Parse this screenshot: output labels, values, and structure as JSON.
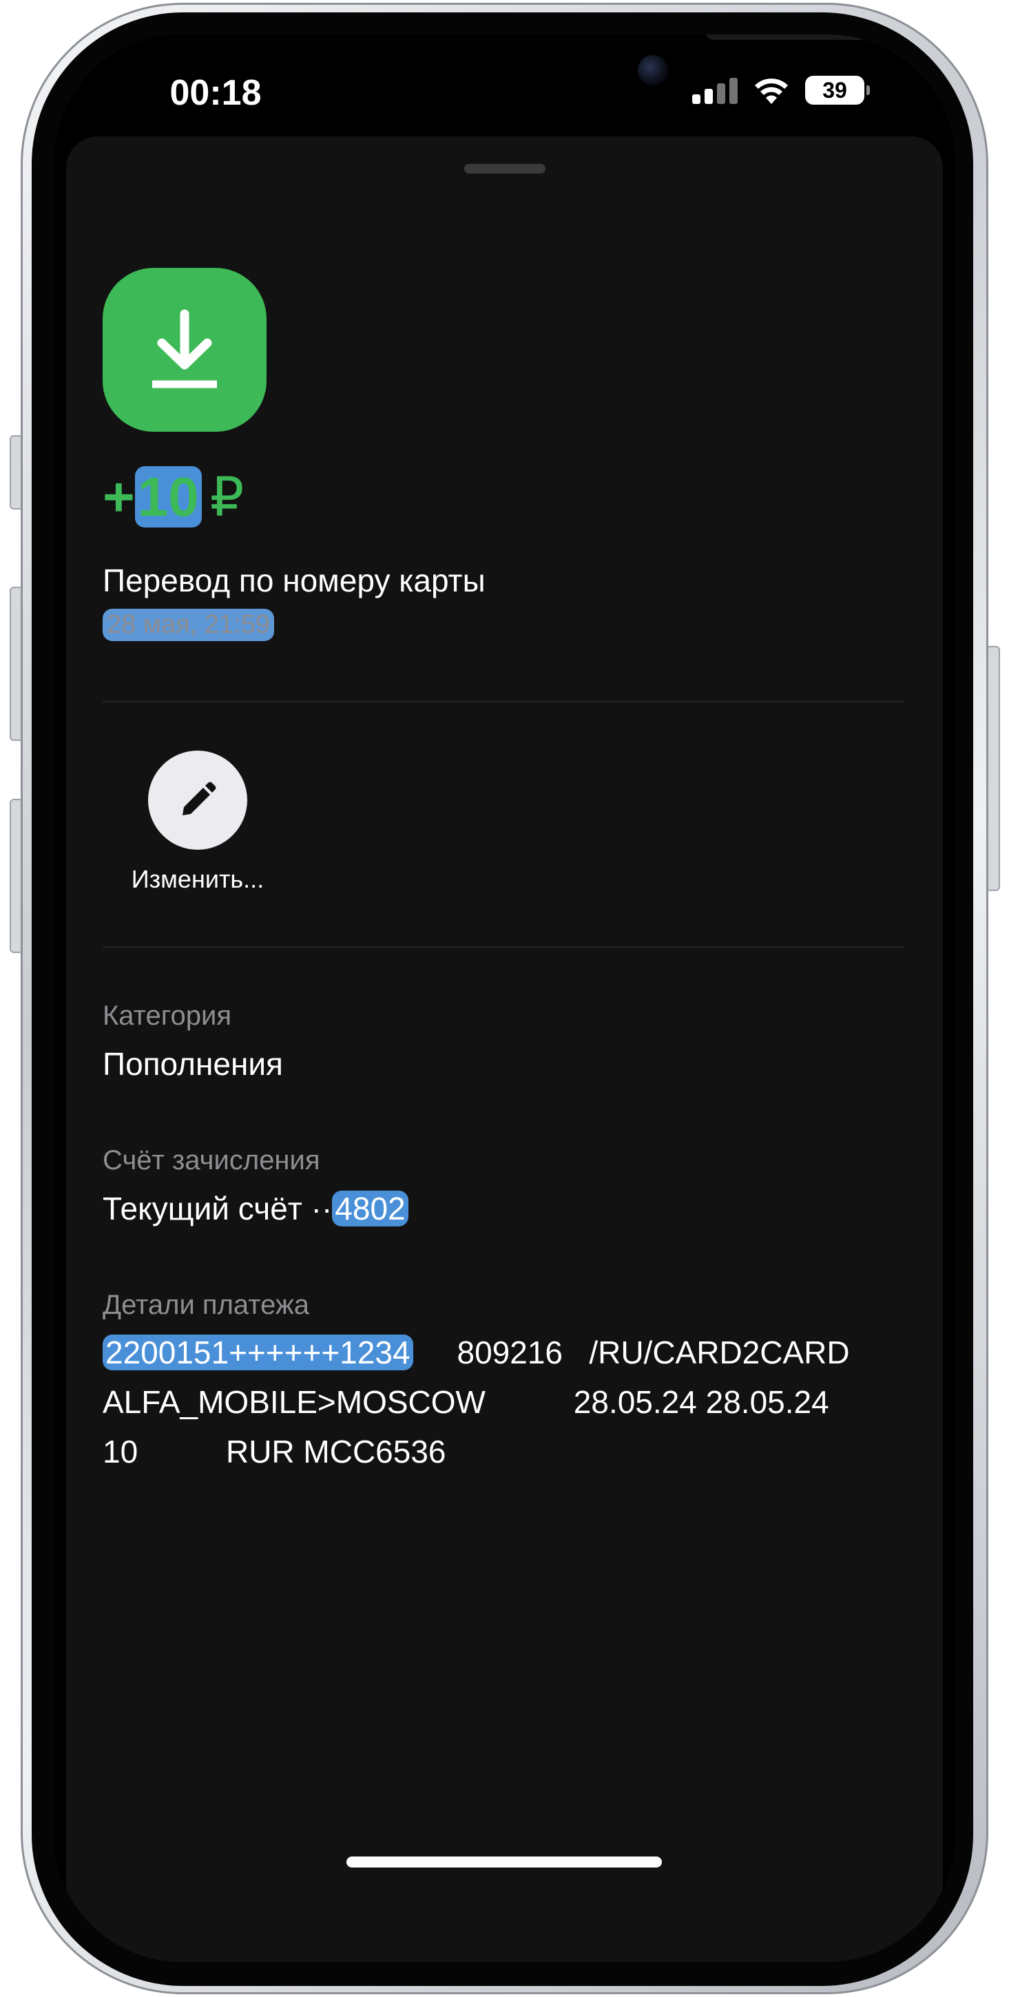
{
  "status_bar": {
    "time": "00:18",
    "battery_level": "39",
    "icons": [
      "cellular-signal-icon",
      "wifi-icon",
      "battery-icon"
    ]
  },
  "operation": {
    "icon": "download-arrow-icon",
    "icon_color": "#3dba57",
    "amount_sign": "+",
    "amount_value": "10",
    "currency": "₽",
    "title": "Перевод по номеру карты",
    "datetime": "28 мая, 21:59"
  },
  "actions": {
    "edit_label": "Изменить...",
    "edit_icon": "pencil-icon"
  },
  "fields": {
    "category": {
      "label": "Категория",
      "value": "Пополнения"
    },
    "account": {
      "label": "Счёт зачисления",
      "value_prefix": "Текущий счёт ··",
      "value_number": "4802"
    },
    "details": {
      "label": "Детали платежа",
      "card_masked": "2200151++++++1234",
      "line1_rest": "809216   /RU/CARD2CARD",
      "line2": "ALFA_MOBILE>MOSCOW          28.05.24 28.05.24",
      "line3": "10          RUR MCC6536"
    }
  },
  "colors": {
    "background": "#121212",
    "accent_green": "#3dba57",
    "secondary_text": "#8e8e93",
    "highlight": "#4a90d9"
  }
}
